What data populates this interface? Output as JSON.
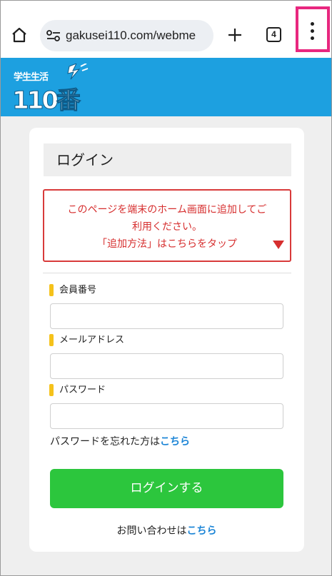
{
  "browser": {
    "url": "gakusei110.com/webme",
    "tab_count": "4"
  },
  "site": {
    "logo_top": "学生生活",
    "logo_main": "110番",
    "brand_color": "#1da0e0"
  },
  "login": {
    "heading": "ログイン",
    "notice": {
      "line1": "このページを端末のホーム画面に追加してご",
      "line2": "利用ください。",
      "line3": "「追加方法」はこちらをタップ"
    },
    "fields": [
      {
        "label": "会員番号",
        "value": ""
      },
      {
        "label": "メールアドレス",
        "value": ""
      },
      {
        "label": "パスワード",
        "value": ""
      }
    ],
    "forgot_prefix": "パスワードを忘れた方は",
    "forgot_link": "こちら",
    "submit_label": "ログインする",
    "contact_prefix": "お問い合わせは",
    "contact_link": "こちら",
    "accent_color": "#2cc63d",
    "link_color": "#1a84d6"
  }
}
